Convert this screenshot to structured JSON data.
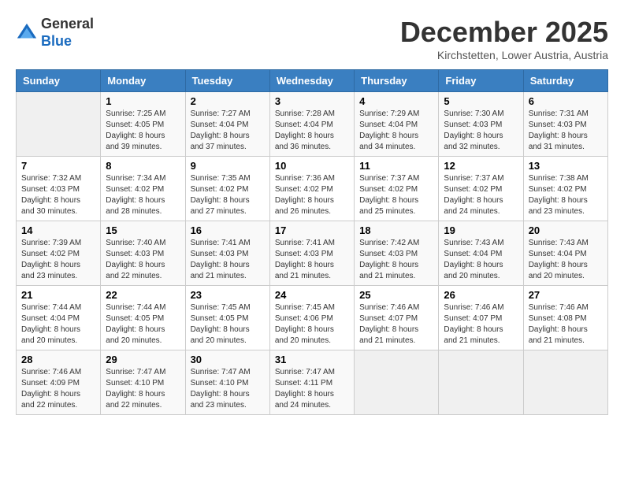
{
  "header": {
    "logo_general": "General",
    "logo_blue": "Blue",
    "month_title": "December 2025",
    "location": "Kirchstetten, Lower Austria, Austria"
  },
  "days_of_week": [
    "Sunday",
    "Monday",
    "Tuesday",
    "Wednesday",
    "Thursday",
    "Friday",
    "Saturday"
  ],
  "weeks": [
    [
      {
        "day": "",
        "sunrise": "",
        "sunset": "",
        "daylight": "",
        "empty": true
      },
      {
        "day": "1",
        "sunrise": "7:25 AM",
        "sunset": "4:05 PM",
        "daylight": "8 hours and 39 minutes."
      },
      {
        "day": "2",
        "sunrise": "7:27 AM",
        "sunset": "4:04 PM",
        "daylight": "8 hours and 37 minutes."
      },
      {
        "day": "3",
        "sunrise": "7:28 AM",
        "sunset": "4:04 PM",
        "daylight": "8 hours and 36 minutes."
      },
      {
        "day": "4",
        "sunrise": "7:29 AM",
        "sunset": "4:04 PM",
        "daylight": "8 hours and 34 minutes."
      },
      {
        "day": "5",
        "sunrise": "7:30 AM",
        "sunset": "4:03 PM",
        "daylight": "8 hours and 32 minutes."
      },
      {
        "day": "6",
        "sunrise": "7:31 AM",
        "sunset": "4:03 PM",
        "daylight": "8 hours and 31 minutes."
      }
    ],
    [
      {
        "day": "7",
        "sunrise": "7:32 AM",
        "sunset": "4:03 PM",
        "daylight": "8 hours and 30 minutes."
      },
      {
        "day": "8",
        "sunrise": "7:34 AM",
        "sunset": "4:02 PM",
        "daylight": "8 hours and 28 minutes."
      },
      {
        "day": "9",
        "sunrise": "7:35 AM",
        "sunset": "4:02 PM",
        "daylight": "8 hours and 27 minutes."
      },
      {
        "day": "10",
        "sunrise": "7:36 AM",
        "sunset": "4:02 PM",
        "daylight": "8 hours and 26 minutes."
      },
      {
        "day": "11",
        "sunrise": "7:37 AM",
        "sunset": "4:02 PM",
        "daylight": "8 hours and 25 minutes."
      },
      {
        "day": "12",
        "sunrise": "7:37 AM",
        "sunset": "4:02 PM",
        "daylight": "8 hours and 24 minutes."
      },
      {
        "day": "13",
        "sunrise": "7:38 AM",
        "sunset": "4:02 PM",
        "daylight": "8 hours and 23 minutes."
      }
    ],
    [
      {
        "day": "14",
        "sunrise": "7:39 AM",
        "sunset": "4:02 PM",
        "daylight": "8 hours and 23 minutes."
      },
      {
        "day": "15",
        "sunrise": "7:40 AM",
        "sunset": "4:03 PM",
        "daylight": "8 hours and 22 minutes."
      },
      {
        "day": "16",
        "sunrise": "7:41 AM",
        "sunset": "4:03 PM",
        "daylight": "8 hours and 21 minutes."
      },
      {
        "day": "17",
        "sunrise": "7:41 AM",
        "sunset": "4:03 PM",
        "daylight": "8 hours and 21 minutes."
      },
      {
        "day": "18",
        "sunrise": "7:42 AM",
        "sunset": "4:03 PM",
        "daylight": "8 hours and 21 minutes."
      },
      {
        "day": "19",
        "sunrise": "7:43 AM",
        "sunset": "4:04 PM",
        "daylight": "8 hours and 20 minutes."
      },
      {
        "day": "20",
        "sunrise": "7:43 AM",
        "sunset": "4:04 PM",
        "daylight": "8 hours and 20 minutes."
      }
    ],
    [
      {
        "day": "21",
        "sunrise": "7:44 AM",
        "sunset": "4:04 PM",
        "daylight": "8 hours and 20 minutes."
      },
      {
        "day": "22",
        "sunrise": "7:44 AM",
        "sunset": "4:05 PM",
        "daylight": "8 hours and 20 minutes."
      },
      {
        "day": "23",
        "sunrise": "7:45 AM",
        "sunset": "4:05 PM",
        "daylight": "8 hours and 20 minutes."
      },
      {
        "day": "24",
        "sunrise": "7:45 AM",
        "sunset": "4:06 PM",
        "daylight": "8 hours and 20 minutes."
      },
      {
        "day": "25",
        "sunrise": "7:46 AM",
        "sunset": "4:07 PM",
        "daylight": "8 hours and 21 minutes."
      },
      {
        "day": "26",
        "sunrise": "7:46 AM",
        "sunset": "4:07 PM",
        "daylight": "8 hours and 21 minutes."
      },
      {
        "day": "27",
        "sunrise": "7:46 AM",
        "sunset": "4:08 PM",
        "daylight": "8 hours and 21 minutes."
      }
    ],
    [
      {
        "day": "28",
        "sunrise": "7:46 AM",
        "sunset": "4:09 PM",
        "daylight": "8 hours and 22 minutes."
      },
      {
        "day": "29",
        "sunrise": "7:47 AM",
        "sunset": "4:10 PM",
        "daylight": "8 hours and 22 minutes."
      },
      {
        "day": "30",
        "sunrise": "7:47 AM",
        "sunset": "4:10 PM",
        "daylight": "8 hours and 23 minutes."
      },
      {
        "day": "31",
        "sunrise": "7:47 AM",
        "sunset": "4:11 PM",
        "daylight": "8 hours and 24 minutes."
      },
      {
        "day": "",
        "sunrise": "",
        "sunset": "",
        "daylight": "",
        "empty": true
      },
      {
        "day": "",
        "sunrise": "",
        "sunset": "",
        "daylight": "",
        "empty": true
      },
      {
        "day": "",
        "sunrise": "",
        "sunset": "",
        "daylight": "",
        "empty": true
      }
    ]
  ]
}
